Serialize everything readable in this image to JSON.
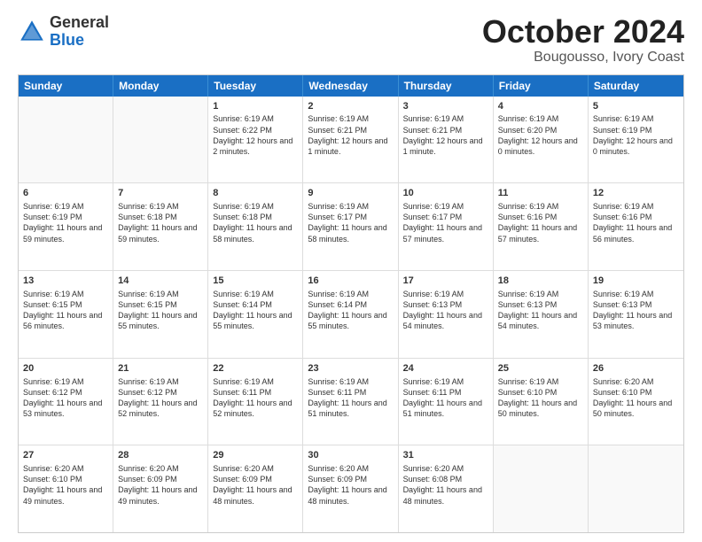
{
  "header": {
    "logo_general": "General",
    "logo_blue": "Blue",
    "month_title": "October 2024",
    "location": "Bougousso, Ivory Coast"
  },
  "weekdays": [
    "Sunday",
    "Monday",
    "Tuesday",
    "Wednesday",
    "Thursday",
    "Friday",
    "Saturday"
  ],
  "rows": [
    [
      {
        "day": "",
        "empty": true
      },
      {
        "day": "",
        "empty": true
      },
      {
        "day": "1",
        "sunrise": "Sunrise: 6:19 AM",
        "sunset": "Sunset: 6:22 PM",
        "daylight": "Daylight: 12 hours and 2 minutes."
      },
      {
        "day": "2",
        "sunrise": "Sunrise: 6:19 AM",
        "sunset": "Sunset: 6:21 PM",
        "daylight": "Daylight: 12 hours and 1 minute."
      },
      {
        "day": "3",
        "sunrise": "Sunrise: 6:19 AM",
        "sunset": "Sunset: 6:21 PM",
        "daylight": "Daylight: 12 hours and 1 minute."
      },
      {
        "day": "4",
        "sunrise": "Sunrise: 6:19 AM",
        "sunset": "Sunset: 6:20 PM",
        "daylight": "Daylight: 12 hours and 0 minutes."
      },
      {
        "day": "5",
        "sunrise": "Sunrise: 6:19 AM",
        "sunset": "Sunset: 6:19 PM",
        "daylight": "Daylight: 12 hours and 0 minutes."
      }
    ],
    [
      {
        "day": "6",
        "sunrise": "Sunrise: 6:19 AM",
        "sunset": "Sunset: 6:19 PM",
        "daylight": "Daylight: 11 hours and 59 minutes."
      },
      {
        "day": "7",
        "sunrise": "Sunrise: 6:19 AM",
        "sunset": "Sunset: 6:18 PM",
        "daylight": "Daylight: 11 hours and 59 minutes."
      },
      {
        "day": "8",
        "sunrise": "Sunrise: 6:19 AM",
        "sunset": "Sunset: 6:18 PM",
        "daylight": "Daylight: 11 hours and 58 minutes."
      },
      {
        "day": "9",
        "sunrise": "Sunrise: 6:19 AM",
        "sunset": "Sunset: 6:17 PM",
        "daylight": "Daylight: 11 hours and 58 minutes."
      },
      {
        "day": "10",
        "sunrise": "Sunrise: 6:19 AM",
        "sunset": "Sunset: 6:17 PM",
        "daylight": "Daylight: 11 hours and 57 minutes."
      },
      {
        "day": "11",
        "sunrise": "Sunrise: 6:19 AM",
        "sunset": "Sunset: 6:16 PM",
        "daylight": "Daylight: 11 hours and 57 minutes."
      },
      {
        "day": "12",
        "sunrise": "Sunrise: 6:19 AM",
        "sunset": "Sunset: 6:16 PM",
        "daylight": "Daylight: 11 hours and 56 minutes."
      }
    ],
    [
      {
        "day": "13",
        "sunrise": "Sunrise: 6:19 AM",
        "sunset": "Sunset: 6:15 PM",
        "daylight": "Daylight: 11 hours and 56 minutes."
      },
      {
        "day": "14",
        "sunrise": "Sunrise: 6:19 AM",
        "sunset": "Sunset: 6:15 PM",
        "daylight": "Daylight: 11 hours and 55 minutes."
      },
      {
        "day": "15",
        "sunrise": "Sunrise: 6:19 AM",
        "sunset": "Sunset: 6:14 PM",
        "daylight": "Daylight: 11 hours and 55 minutes."
      },
      {
        "day": "16",
        "sunrise": "Sunrise: 6:19 AM",
        "sunset": "Sunset: 6:14 PM",
        "daylight": "Daylight: 11 hours and 55 minutes."
      },
      {
        "day": "17",
        "sunrise": "Sunrise: 6:19 AM",
        "sunset": "Sunset: 6:13 PM",
        "daylight": "Daylight: 11 hours and 54 minutes."
      },
      {
        "day": "18",
        "sunrise": "Sunrise: 6:19 AM",
        "sunset": "Sunset: 6:13 PM",
        "daylight": "Daylight: 11 hours and 54 minutes."
      },
      {
        "day": "19",
        "sunrise": "Sunrise: 6:19 AM",
        "sunset": "Sunset: 6:13 PM",
        "daylight": "Daylight: 11 hours and 53 minutes."
      }
    ],
    [
      {
        "day": "20",
        "sunrise": "Sunrise: 6:19 AM",
        "sunset": "Sunset: 6:12 PM",
        "daylight": "Daylight: 11 hours and 53 minutes."
      },
      {
        "day": "21",
        "sunrise": "Sunrise: 6:19 AM",
        "sunset": "Sunset: 6:12 PM",
        "daylight": "Daylight: 11 hours and 52 minutes."
      },
      {
        "day": "22",
        "sunrise": "Sunrise: 6:19 AM",
        "sunset": "Sunset: 6:11 PM",
        "daylight": "Daylight: 11 hours and 52 minutes."
      },
      {
        "day": "23",
        "sunrise": "Sunrise: 6:19 AM",
        "sunset": "Sunset: 6:11 PM",
        "daylight": "Daylight: 11 hours and 51 minutes."
      },
      {
        "day": "24",
        "sunrise": "Sunrise: 6:19 AM",
        "sunset": "Sunset: 6:11 PM",
        "daylight": "Daylight: 11 hours and 51 minutes."
      },
      {
        "day": "25",
        "sunrise": "Sunrise: 6:19 AM",
        "sunset": "Sunset: 6:10 PM",
        "daylight": "Daylight: 11 hours and 50 minutes."
      },
      {
        "day": "26",
        "sunrise": "Sunrise: 6:20 AM",
        "sunset": "Sunset: 6:10 PM",
        "daylight": "Daylight: 11 hours and 50 minutes."
      }
    ],
    [
      {
        "day": "27",
        "sunrise": "Sunrise: 6:20 AM",
        "sunset": "Sunset: 6:10 PM",
        "daylight": "Daylight: 11 hours and 49 minutes."
      },
      {
        "day": "28",
        "sunrise": "Sunrise: 6:20 AM",
        "sunset": "Sunset: 6:09 PM",
        "daylight": "Daylight: 11 hours and 49 minutes."
      },
      {
        "day": "29",
        "sunrise": "Sunrise: 6:20 AM",
        "sunset": "Sunset: 6:09 PM",
        "daylight": "Daylight: 11 hours and 48 minutes."
      },
      {
        "day": "30",
        "sunrise": "Sunrise: 6:20 AM",
        "sunset": "Sunset: 6:09 PM",
        "daylight": "Daylight: 11 hours and 48 minutes."
      },
      {
        "day": "31",
        "sunrise": "Sunrise: 6:20 AM",
        "sunset": "Sunset: 6:08 PM",
        "daylight": "Daylight: 11 hours and 48 minutes."
      },
      {
        "day": "",
        "empty": true
      },
      {
        "day": "",
        "empty": true
      }
    ]
  ]
}
